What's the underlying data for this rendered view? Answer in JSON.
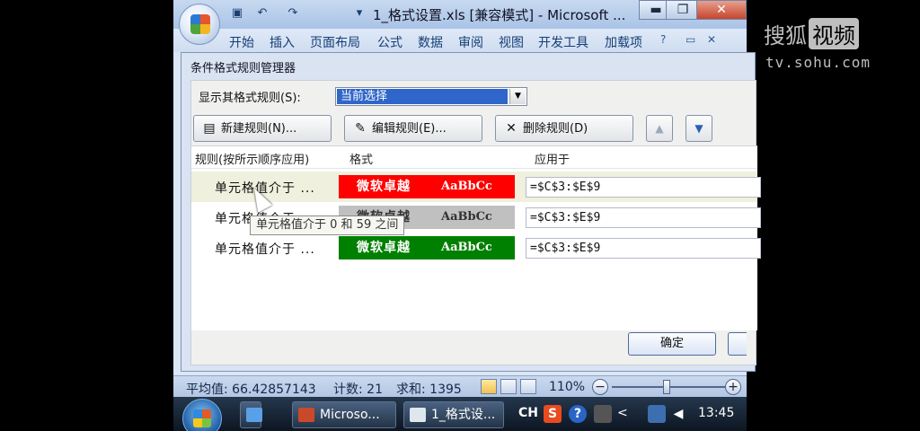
{
  "window": {
    "title": "1_格式设置.xls  [兼容模式] - Microsoft ...",
    "minimize": "▬",
    "restore": "❐",
    "close": "✕"
  },
  "ribbon": {
    "tabs": [
      "开始",
      "插入",
      "页面布局",
      "公式",
      "数据",
      "审阅",
      "视图",
      "开发工具",
      "加载项"
    ],
    "help": "?",
    "min": "▭",
    "close": "✕"
  },
  "dialog": {
    "title": "条件格式规则管理器",
    "show_label": "显示其格式规则(S):",
    "scope_value": "当前选择",
    "buttons": {
      "new": "新建规则(N)...",
      "edit": "编辑规则(E)...",
      "delete": "删除规则(D)",
      "up": "▲",
      "down": "▼"
    },
    "columns": {
      "rule": "规则(按所示顺序应用)",
      "format": "格式",
      "applies": "应用于"
    },
    "rules": [
      {
        "name": "单元格值介于 ...",
        "preview_cn": "微软卓越",
        "preview_en": "AaBbCc",
        "applies_to": "=$C$3:$E$9",
        "bg": "#ff0000",
        "fg": "#ffffff"
      },
      {
        "name": "单元格值介于 ...",
        "preview_cn": "微软卓越",
        "preview_en": "AaBbCc",
        "applies_to": "=$C$3:$E$9",
        "bg": "#c0c0c0",
        "fg": "#333333"
      },
      {
        "name": "单元格值介于 ...",
        "preview_cn": "微软卓越",
        "preview_en": "AaBbCc",
        "applies_to": "=$C$3:$E$9",
        "bg": "#008000",
        "fg": "#ffffff"
      }
    ],
    "tooltip": "单元格值介于 0 和 59 之间",
    "ok": "确定"
  },
  "statusbar": {
    "average": "平均值: 66.42857143",
    "count": "计数: 21",
    "sum": "求和: 1395",
    "zoom": "110%",
    "zoom_minus": "−",
    "zoom_plus": "+"
  },
  "taskbar": {
    "items": [
      "Microso...",
      "1_格式设..."
    ],
    "lang": "CH",
    "time": "13:45",
    "s_icon": "S",
    "help_icon": "?",
    "arrow": "<"
  },
  "watermark": {
    "name": "搜狐",
    "video": "视频",
    "url": "tv.sohu.com"
  }
}
